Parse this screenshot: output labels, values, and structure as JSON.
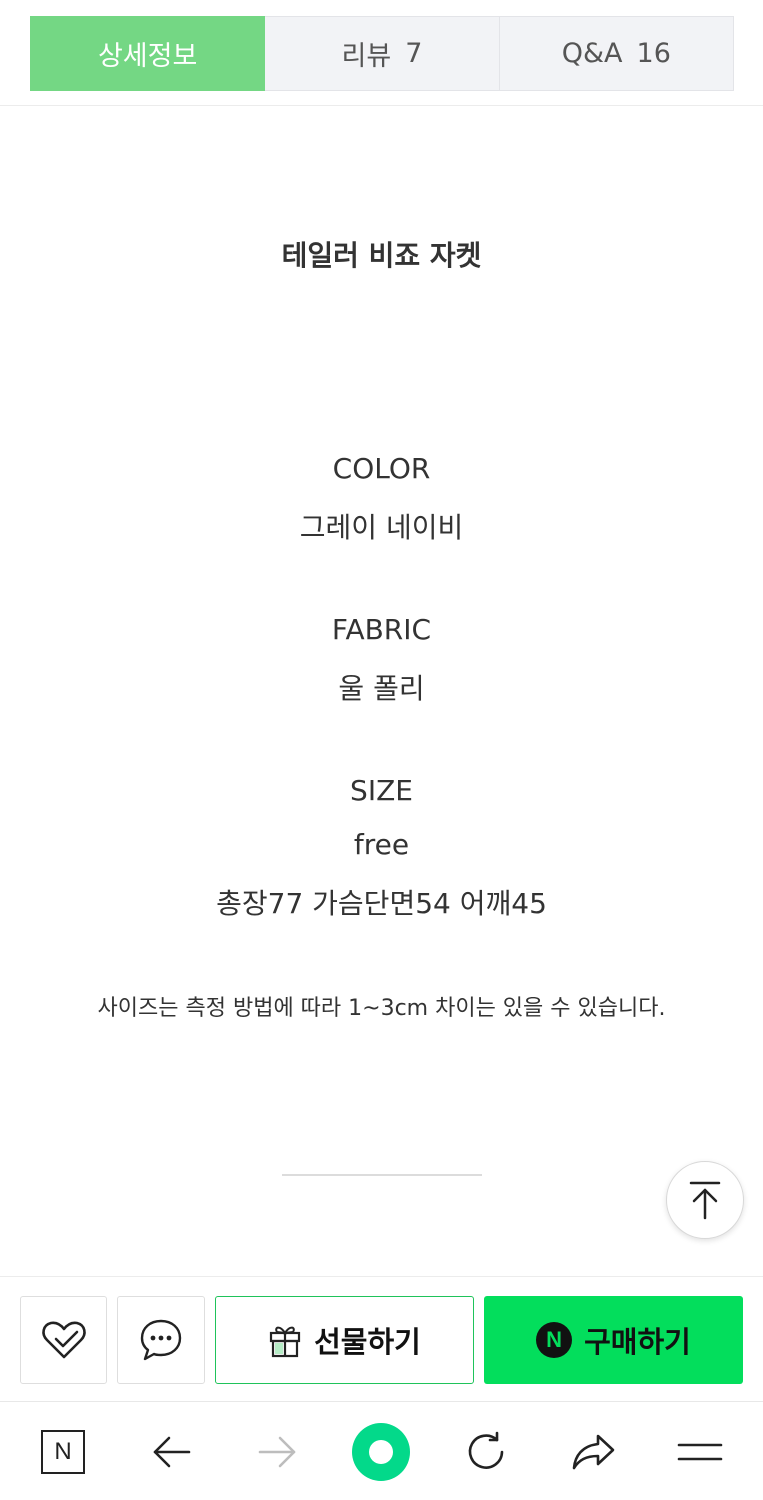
{
  "tabs": [
    {
      "label": "상세정보",
      "count": ""
    },
    {
      "label": "리뷰",
      "count": "7"
    },
    {
      "label": "Q&A",
      "count": "16"
    }
  ],
  "product": {
    "title": "테일러 비죠 자켓",
    "color_heading": "COLOR",
    "color_value": "그레이 네이비",
    "fabric_heading": "FABRIC",
    "fabric_value": "울 폴리",
    "size_heading": "SIZE",
    "size_value": "free",
    "size_detail": "총장77 가슴단면54 어깨45",
    "note": "사이즈는 측정 방법에 따라 1~3cm 차이는 있을 수 있습니다."
  },
  "purchase_bar": {
    "gift_label": "선물하기",
    "buy_label": "구매하기",
    "npay_glyph": "N"
  },
  "nav": {
    "naver_glyph": "N"
  },
  "colors": {
    "tab_active": "#74d784",
    "buy_button": "#03de5c",
    "gift_border": "#1fc35a"
  }
}
